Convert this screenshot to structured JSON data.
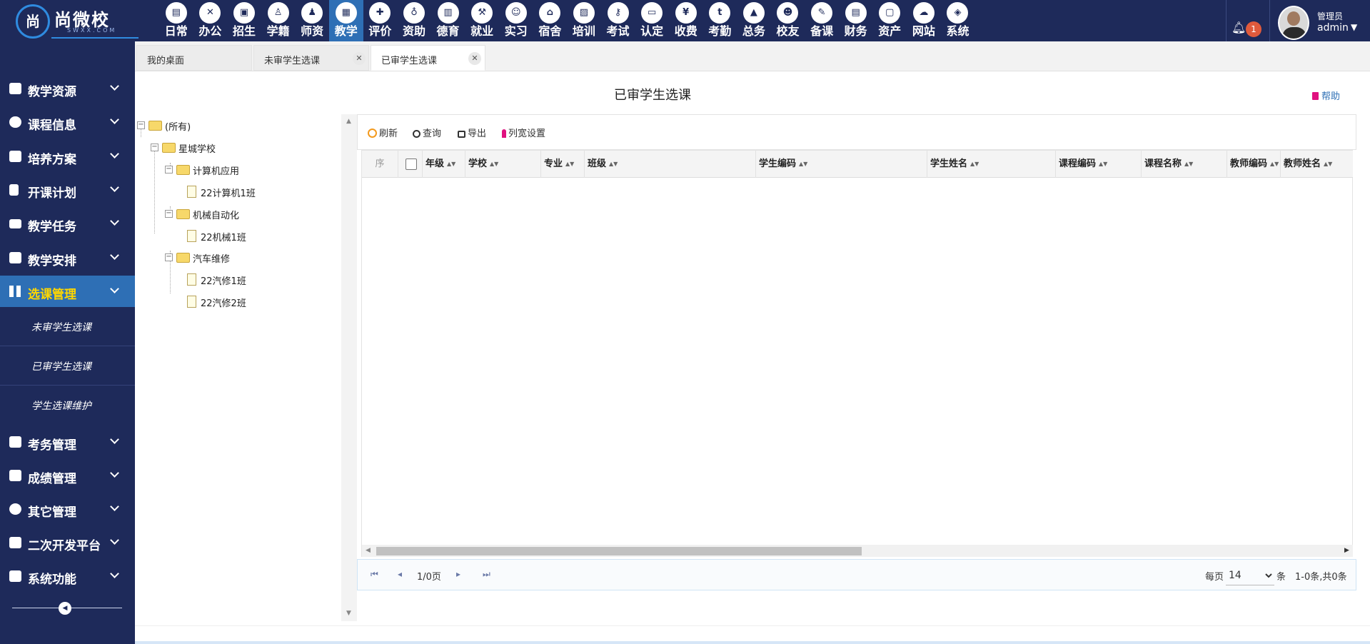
{
  "brand": {
    "name": "尚微校",
    "subtitle": "SWXX.COM",
    "mark": "尚"
  },
  "modules": [
    {
      "label": "日常",
      "icon": "document-icon"
    },
    {
      "label": "办公",
      "icon": "office-icon"
    },
    {
      "label": "招生",
      "icon": "bus-icon"
    },
    {
      "label": "学籍",
      "icon": "student-icon"
    },
    {
      "label": "师资",
      "icon": "teacher-icon"
    },
    {
      "label": "教学",
      "icon": "calendar-icon",
      "active": true
    },
    {
      "label": "评价",
      "icon": "evaluate-icon"
    },
    {
      "label": "资助",
      "icon": "aid-icon"
    },
    {
      "label": "德育",
      "icon": "book-icon"
    },
    {
      "label": "就业",
      "icon": "hammer-icon"
    },
    {
      "label": "实习",
      "icon": "internship-icon"
    },
    {
      "label": "宿舍",
      "icon": "home-icon"
    },
    {
      "label": "培训",
      "icon": "training-icon"
    },
    {
      "label": "考试",
      "icon": "key-icon"
    },
    {
      "label": "认定",
      "icon": "monitor-icon"
    },
    {
      "label": "收费",
      "icon": "yen-icon"
    },
    {
      "label": "考勤",
      "icon": "attendance-icon"
    },
    {
      "label": "总务",
      "icon": "chart-icon"
    },
    {
      "label": "校友",
      "icon": "alumni-icon"
    },
    {
      "label": "备课",
      "icon": "edit-icon"
    },
    {
      "label": "财务",
      "icon": "newspaper-icon"
    },
    {
      "label": "资产",
      "icon": "train-icon"
    },
    {
      "label": "网站",
      "icon": "cloud-icon"
    },
    {
      "label": "系统",
      "icon": "cube-icon"
    }
  ],
  "header": {
    "notification_count": "1",
    "user_role": "管理员",
    "user_name": "admin"
  },
  "sidebar": {
    "items": [
      {
        "label": "教学资源",
        "icon": "book-icon"
      },
      {
        "label": "课程信息",
        "icon": "cloud-icon"
      },
      {
        "label": "培养方案",
        "icon": "envelope-icon"
      },
      {
        "label": "开课计划",
        "icon": "file-icon"
      },
      {
        "label": "教学任务",
        "icon": "folder-icon"
      },
      {
        "label": "教学安排",
        "icon": "schedule-icon"
      },
      {
        "label": "选课管理",
        "icon": "pause-icon",
        "active": true
      },
      {
        "label": "考务管理",
        "icon": "square-icon"
      },
      {
        "label": "成绩管理",
        "icon": "grid-icon"
      },
      {
        "label": "其它管理",
        "icon": "pie-icon"
      },
      {
        "label": "二次开发平台",
        "icon": "play-icon"
      },
      {
        "label": "系统功能",
        "icon": "v-icon"
      }
    ],
    "subitems": [
      "未审学生选课",
      "已审学生选课",
      "学生选课维护"
    ]
  },
  "tabs": [
    {
      "label": "我的桌面",
      "closable": false
    },
    {
      "label": "未审学生选课",
      "closable": true
    },
    {
      "label": "已审学生选课",
      "closable": true,
      "active": true
    }
  ],
  "page": {
    "title": "已审学生选课",
    "help": "帮助"
  },
  "tree": {
    "root": "(所有)",
    "school": "星城学校",
    "majors": [
      {
        "name": "计算机应用",
        "classes": [
          "22计算机1班"
        ]
      },
      {
        "name": "机械自动化",
        "classes": [
          "22机械1班"
        ]
      },
      {
        "name": "汽车维修",
        "classes": [
          "22汽修1班",
          "22汽修2班"
        ]
      }
    ]
  },
  "toolbar": {
    "refresh": "刷新",
    "query": "查询",
    "export": "导出",
    "column_settings": "列宽设置"
  },
  "grid": {
    "columns": [
      "序",
      "",
      "年级",
      "学校",
      "专业",
      "班级",
      "学生编码",
      "学生姓名",
      "课程编码",
      "课程名称",
      "教师编码",
      "教师姓名"
    ],
    "rows": []
  },
  "pager": {
    "page_info": "1/0页",
    "per_page_label": "每页",
    "per_page_value": "14",
    "per_page_unit": "条",
    "summary": "1-0条,共0条"
  },
  "colors": {
    "nav_bg": "#1e2a5a",
    "active_bg": "#2e6fb5",
    "active_text": "#ffd700",
    "badge": "#e05a3c"
  }
}
